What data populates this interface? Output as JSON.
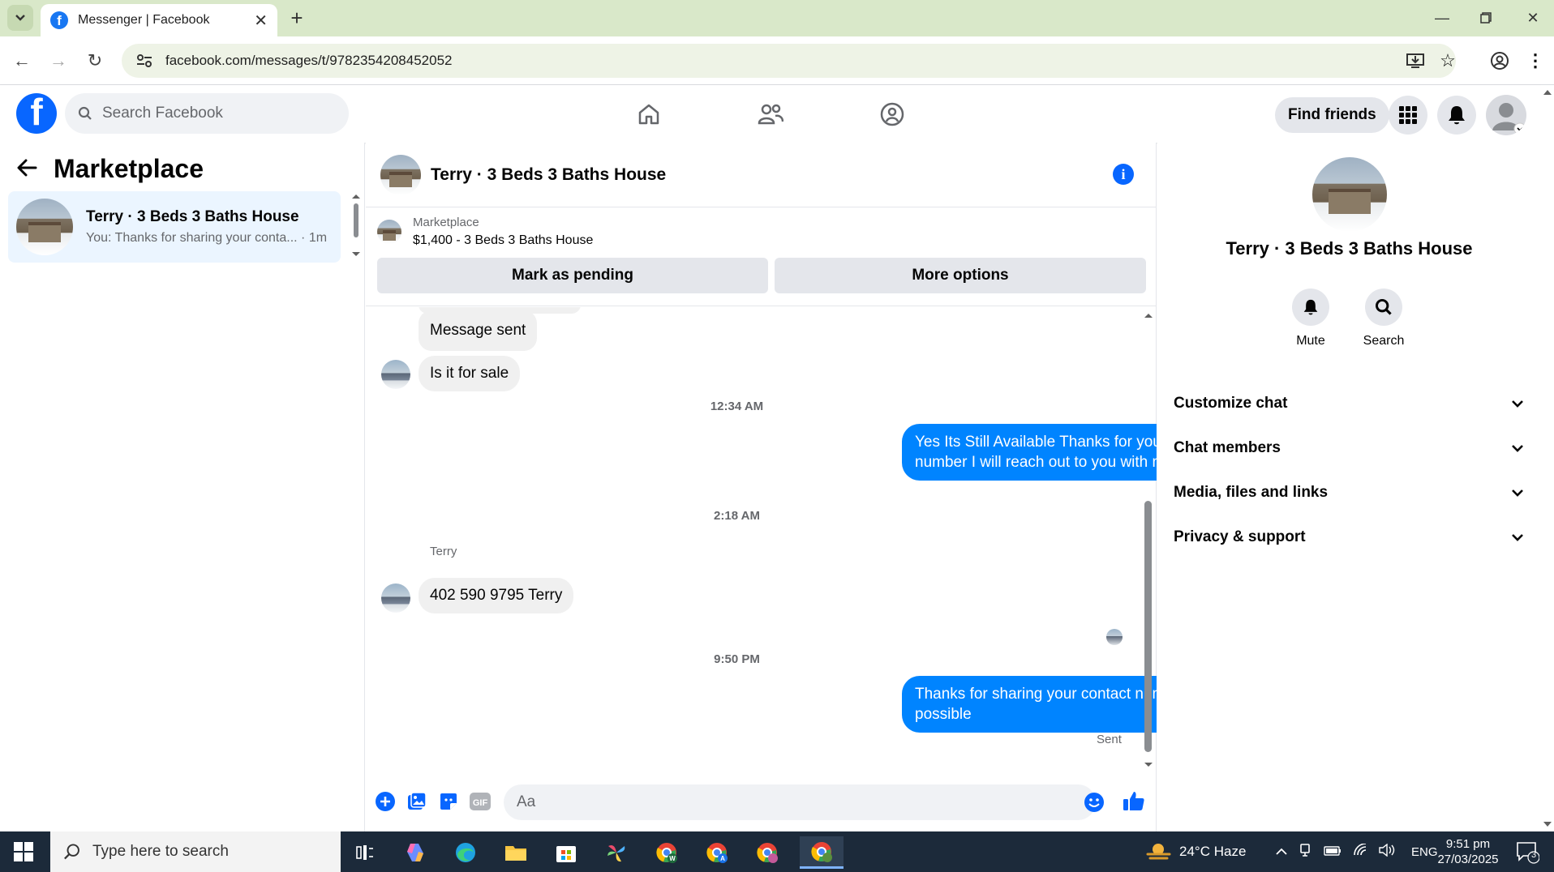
{
  "browser": {
    "tab_title": "Messenger | Facebook",
    "url": "facebook.com/messages/t/9782354208452052"
  },
  "fb_header": {
    "search_placeholder": "Search Facebook",
    "find_friends": "Find friends",
    "brand_color": "#0866ff"
  },
  "left_panel": {
    "title": "Marketplace",
    "conversation": {
      "name": "Terry · 3 Beds 3 Baths House",
      "preview": "You: Thanks for sharing your conta... · 1m"
    }
  },
  "chat": {
    "header_name": "Terry · 3 Beds 3 Baths House",
    "marketplace_label": "Marketplace",
    "listing": "$1,400 - 3 Beds 3 Baths House",
    "mark_pending": "Mark as pending",
    "more_options": "More options",
    "messages": {
      "m1": "Message sent",
      "m2": "Is it for sale",
      "t1": "12:34 AM",
      "m3": "Yes Its Still Available Thanks for your interest in the house kindly text your phone number I will reach out to you with more details of the property",
      "t2": "2:18 AM",
      "sender": "Terry",
      "m4": "402 590 9795 Terry",
      "t3": "9:50 PM",
      "m5": "Thanks for sharing your contact number I will contact at your number as soon as possible",
      "status": "Sent"
    },
    "composer_placeholder": "Aa",
    "outgoing_color": "#0084ff"
  },
  "right_panel": {
    "name": "Terry · 3 Beds 3 Baths House",
    "mute": "Mute",
    "search": "Search",
    "sections": [
      "Customize chat",
      "Chat members",
      "Media, files and links",
      "Privacy & support"
    ]
  },
  "taskbar": {
    "search_placeholder": "Type here to search",
    "weather": "24°C  Haze",
    "language": "ENG",
    "time": "9:51 pm",
    "date": "27/03/2025",
    "notification_count": "3"
  }
}
